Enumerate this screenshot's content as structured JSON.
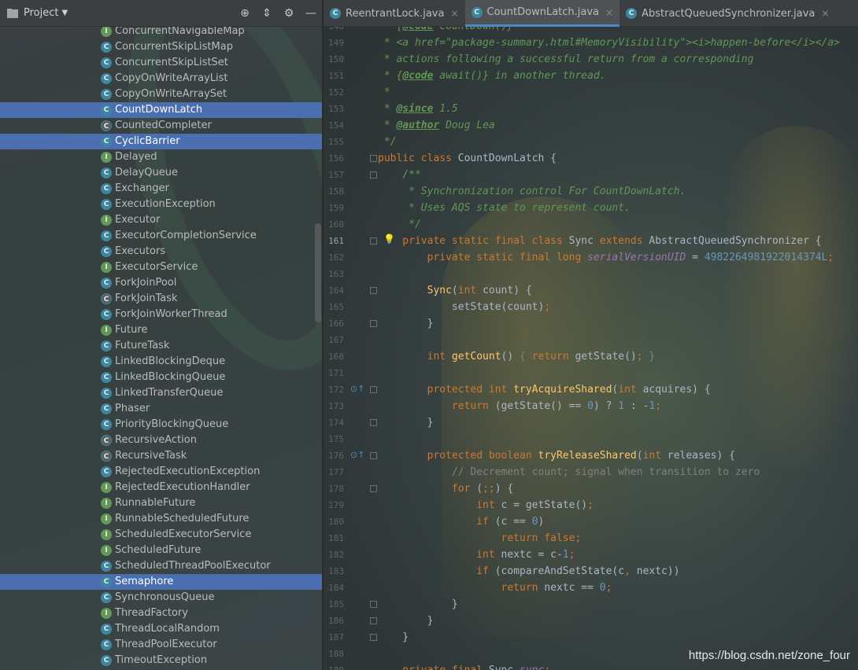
{
  "project": {
    "title": "Project",
    "items": [
      {
        "label": "ConcurrentNavigableMap",
        "kind": "I",
        "selected": false
      },
      {
        "label": "ConcurrentSkipListMap",
        "kind": "C",
        "selected": false
      },
      {
        "label": "ConcurrentSkipListSet",
        "kind": "C",
        "selected": false
      },
      {
        "label": "CopyOnWriteArrayList",
        "kind": "C",
        "selected": false
      },
      {
        "label": "CopyOnWriteArraySet",
        "kind": "C",
        "selected": false
      },
      {
        "label": "CountDownLatch",
        "kind": "C",
        "selected": true
      },
      {
        "label": "CountedCompleter",
        "kind": "A",
        "selected": false
      },
      {
        "label": "CyclicBarrier",
        "kind": "C",
        "selected": true
      },
      {
        "label": "Delayed",
        "kind": "I",
        "selected": false
      },
      {
        "label": "DelayQueue",
        "kind": "C",
        "selected": false
      },
      {
        "label": "Exchanger",
        "kind": "C",
        "selected": false
      },
      {
        "label": "ExecutionException",
        "kind": "C",
        "selected": false
      },
      {
        "label": "Executor",
        "kind": "I",
        "selected": false
      },
      {
        "label": "ExecutorCompletionService",
        "kind": "C",
        "selected": false
      },
      {
        "label": "Executors",
        "kind": "C",
        "selected": false
      },
      {
        "label": "ExecutorService",
        "kind": "I",
        "selected": false
      },
      {
        "label": "ForkJoinPool",
        "kind": "C",
        "selected": false
      },
      {
        "label": "ForkJoinTask",
        "kind": "A",
        "selected": false
      },
      {
        "label": "ForkJoinWorkerThread",
        "kind": "C",
        "selected": false
      },
      {
        "label": "Future",
        "kind": "I",
        "selected": false
      },
      {
        "label": "FutureTask",
        "kind": "C",
        "selected": false
      },
      {
        "label": "LinkedBlockingDeque",
        "kind": "C",
        "selected": false
      },
      {
        "label": "LinkedBlockingQueue",
        "kind": "C",
        "selected": false
      },
      {
        "label": "LinkedTransferQueue",
        "kind": "C",
        "selected": false
      },
      {
        "label": "Phaser",
        "kind": "C",
        "selected": false
      },
      {
        "label": "PriorityBlockingQueue",
        "kind": "C",
        "selected": false
      },
      {
        "label": "RecursiveAction",
        "kind": "A",
        "selected": false
      },
      {
        "label": "RecursiveTask",
        "kind": "A",
        "selected": false
      },
      {
        "label": "RejectedExecutionException",
        "kind": "C",
        "selected": false
      },
      {
        "label": "RejectedExecutionHandler",
        "kind": "I",
        "selected": false
      },
      {
        "label": "RunnableFuture",
        "kind": "I",
        "selected": false
      },
      {
        "label": "RunnableScheduledFuture",
        "kind": "I",
        "selected": false
      },
      {
        "label": "ScheduledExecutorService",
        "kind": "I",
        "selected": false
      },
      {
        "label": "ScheduledFuture",
        "kind": "I",
        "selected": false
      },
      {
        "label": "ScheduledThreadPoolExecutor",
        "kind": "C",
        "selected": false
      },
      {
        "label": "Semaphore",
        "kind": "C",
        "selected": true
      },
      {
        "label": "SynchronousQueue",
        "kind": "C",
        "selected": false
      },
      {
        "label": "ThreadFactory",
        "kind": "I",
        "selected": false
      },
      {
        "label": "ThreadLocalRandom",
        "kind": "C",
        "selected": false
      },
      {
        "label": "ThreadPoolExecutor",
        "kind": "C",
        "selected": false
      },
      {
        "label": "TimeoutException",
        "kind": "C",
        "selected": false
      }
    ]
  },
  "tabs": [
    {
      "label": "ReentrantLock.java",
      "active": false
    },
    {
      "label": "CountDownLatch.java",
      "active": true
    },
    {
      "label": "AbstractQueuedSynchronizer.java",
      "active": false
    }
  ],
  "editor": {
    "current_line": "161",
    "lines": [
      {
        "n": "148",
        "tokens": [
          [
            "cm",
            " * {"
          ],
          [
            "tag",
            "@code"
          ],
          [
            "cm",
            " countDown()}"
          ]
        ]
      },
      {
        "n": "149",
        "tokens": [
          [
            "cm",
            " * <a href=\"package-summary.html#MemoryVisibility\"><i>happen-before</i></a>"
          ]
        ]
      },
      {
        "n": "150",
        "tokens": [
          [
            "cm",
            " * actions following a successful return from a corresponding"
          ]
        ]
      },
      {
        "n": "151",
        "tokens": [
          [
            "cm",
            " * {"
          ],
          [
            "tag",
            "@code"
          ],
          [
            "cm",
            " await()} in another thread."
          ]
        ]
      },
      {
        "n": "152",
        "tokens": [
          [
            "cm",
            " *"
          ]
        ]
      },
      {
        "n": "153",
        "tokens": [
          [
            "cm",
            " * "
          ],
          [
            "tag",
            "@since"
          ],
          [
            "cm",
            " 1.5"
          ]
        ]
      },
      {
        "n": "154",
        "tokens": [
          [
            "cm",
            " * "
          ],
          [
            "tag",
            "@author"
          ],
          [
            "cm",
            " Doug Lea"
          ]
        ]
      },
      {
        "n": "155",
        "tokens": [
          [
            "cm",
            " */"
          ]
        ]
      },
      {
        "n": "156",
        "tokens": [
          [
            "kw",
            "public class "
          ],
          [
            "pl",
            "CountDownLatch {"
          ]
        ]
      },
      {
        "n": "157",
        "tokens": [
          [
            "cm",
            "    /**"
          ]
        ]
      },
      {
        "n": "158",
        "tokens": [
          [
            "cm",
            "     * Synchronization control For CountDownLatch."
          ]
        ]
      },
      {
        "n": "159",
        "tokens": [
          [
            "cm",
            "     * Uses AQS state to represent count."
          ]
        ]
      },
      {
        "n": "160",
        "tokens": [
          [
            "cm",
            "     */"
          ]
        ]
      },
      {
        "n": "161",
        "tokens": [
          [
            "kw",
            "    private static final class "
          ],
          [
            "pl",
            "Sync "
          ],
          [
            "kw",
            "extends "
          ],
          [
            "pl",
            "AbstractQueuedSynchronizer {"
          ]
        ]
      },
      {
        "n": "162",
        "tokens": [
          [
            "kw",
            "        private static final long "
          ],
          [
            "fld",
            "serialVersionUID"
          ],
          [
            "pl",
            " = "
          ],
          [
            "num",
            "4982264981922014374L"
          ],
          [
            "kw",
            ";"
          ]
        ]
      },
      {
        "n": "163",
        "tokens": [
          [
            "pl",
            ""
          ]
        ]
      },
      {
        "n": "164",
        "tokens": [
          [
            "fn",
            "        Sync"
          ],
          [
            "pl",
            "("
          ],
          [
            "kw",
            "int "
          ],
          [
            "pl",
            "count) {"
          ]
        ]
      },
      {
        "n": "165",
        "tokens": [
          [
            "pl",
            "            setState(count)"
          ],
          [
            "kw",
            ";"
          ]
        ]
      },
      {
        "n": "166",
        "tokens": [
          [
            "pl",
            "        }"
          ]
        ]
      },
      {
        "n": "167",
        "tokens": [
          [
            "pl",
            ""
          ]
        ]
      },
      {
        "n": "168",
        "tokens": [
          [
            "kw",
            "        int "
          ],
          [
            "fn",
            "getCount"
          ],
          [
            "pl",
            "() "
          ],
          [
            "lc",
            "{ "
          ],
          [
            "kw",
            "return "
          ],
          [
            "pl",
            "getState()"
          ],
          [
            "kw",
            ";"
          ],
          [
            "lc",
            " }"
          ]
        ]
      },
      {
        "n": "171",
        "tokens": [
          [
            "pl",
            ""
          ]
        ]
      },
      {
        "n": "172",
        "tokens": [
          [
            "kw",
            "        protected int "
          ],
          [
            "fn",
            "tryAcquireShared"
          ],
          [
            "pl",
            "("
          ],
          [
            "kw",
            "int "
          ],
          [
            "pl",
            "acquires) {"
          ]
        ]
      },
      {
        "n": "173",
        "tokens": [
          [
            "kw",
            "            return "
          ],
          [
            "pl",
            "(getState() == "
          ],
          [
            "num",
            "0"
          ],
          [
            "pl",
            ") ? "
          ],
          [
            "num",
            "1"
          ],
          [
            "pl",
            " : -"
          ],
          [
            "num",
            "1"
          ],
          [
            "kw",
            ";"
          ]
        ]
      },
      {
        "n": "174",
        "tokens": [
          [
            "pl",
            "        }"
          ]
        ]
      },
      {
        "n": "175",
        "tokens": [
          [
            "pl",
            ""
          ]
        ]
      },
      {
        "n": "176",
        "tokens": [
          [
            "kw",
            "        protected boolean "
          ],
          [
            "fn",
            "tryReleaseShared"
          ],
          [
            "pl",
            "("
          ],
          [
            "kw",
            "int "
          ],
          [
            "pl",
            "releases) {"
          ]
        ]
      },
      {
        "n": "177",
        "tokens": [
          [
            "lc",
            "            // Decrement count; signal when transition to zero"
          ]
        ]
      },
      {
        "n": "178",
        "tokens": [
          [
            "kw",
            "            for "
          ],
          [
            "pl",
            "("
          ],
          [
            "kw",
            ";;"
          ],
          [
            "pl",
            ") {"
          ]
        ]
      },
      {
        "n": "179",
        "tokens": [
          [
            "kw",
            "                int "
          ],
          [
            "pl",
            "c = getState()"
          ],
          [
            "kw",
            ";"
          ]
        ]
      },
      {
        "n": "180",
        "tokens": [
          [
            "kw",
            "                if "
          ],
          [
            "pl",
            "(c == "
          ],
          [
            "num",
            "0"
          ],
          [
            "pl",
            ")"
          ]
        ]
      },
      {
        "n": "181",
        "tokens": [
          [
            "kw",
            "                    return false;"
          ]
        ]
      },
      {
        "n": "182",
        "tokens": [
          [
            "kw",
            "                int "
          ],
          [
            "pl",
            "nextc = c-"
          ],
          [
            "num",
            "1"
          ],
          [
            "kw",
            ";"
          ]
        ]
      },
      {
        "n": "183",
        "tokens": [
          [
            "kw",
            "                if "
          ],
          [
            "pl",
            "(compareAndSetState(c"
          ],
          [
            "kw",
            ", "
          ],
          [
            "pl",
            "nextc))"
          ]
        ]
      },
      {
        "n": "184",
        "tokens": [
          [
            "kw",
            "                    return "
          ],
          [
            "pl",
            "nextc == "
          ],
          [
            "num",
            "0"
          ],
          [
            "kw",
            ";"
          ]
        ]
      },
      {
        "n": "185",
        "tokens": [
          [
            "pl",
            "            }"
          ]
        ]
      },
      {
        "n": "186",
        "tokens": [
          [
            "pl",
            "        }"
          ]
        ]
      },
      {
        "n": "187",
        "tokens": [
          [
            "pl",
            "    }"
          ]
        ]
      },
      {
        "n": "188",
        "tokens": [
          [
            "pl",
            ""
          ]
        ]
      },
      {
        "n": "189",
        "tokens": [
          [
            "kw",
            "    private final "
          ],
          [
            "pl",
            "Sync "
          ],
          [
            "fld",
            "sync"
          ],
          [
            "kw",
            ";"
          ]
        ]
      }
    ]
  },
  "watermark": "https://blog.csdn.net/zone_four"
}
